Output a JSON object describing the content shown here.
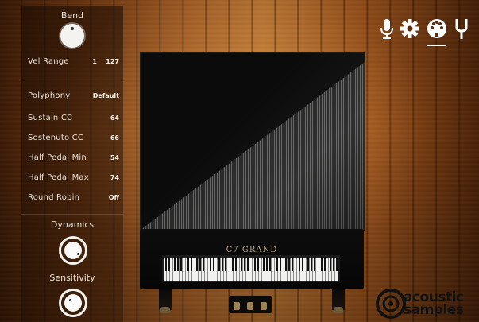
{
  "controls": {
    "bend_label": "Bend",
    "vel_range_label": "Vel Range",
    "vel_range_min": "1",
    "vel_range_max": "127",
    "dynamics_label": "Dynamics",
    "sensitivity_label": "Sensitivity"
  },
  "settings": [
    {
      "label": "Polyphony",
      "value": "Default"
    },
    {
      "label": "Sustain CC",
      "value": "64"
    },
    {
      "label": "Sostenuto CC",
      "value": "66"
    },
    {
      "label": "Half Pedal Min",
      "value": "54"
    },
    {
      "label": "Half Pedal Max",
      "value": "74"
    },
    {
      "label": "Round Robin",
      "value": "Off"
    }
  ],
  "piano": {
    "brand_text": "C7 GRAND"
  },
  "toolbar": {
    "icons": [
      "microphone-icon",
      "gear-icon",
      "midi-icon",
      "tuning-fork-icon"
    ],
    "active": "midi-icon"
  },
  "logo": {
    "line1": "acoustic",
    "line2": "samples"
  },
  "colors": {
    "panel_text": "#e9e2d8",
    "knob": "#f5f3f0",
    "wood": "#b8692a"
  }
}
